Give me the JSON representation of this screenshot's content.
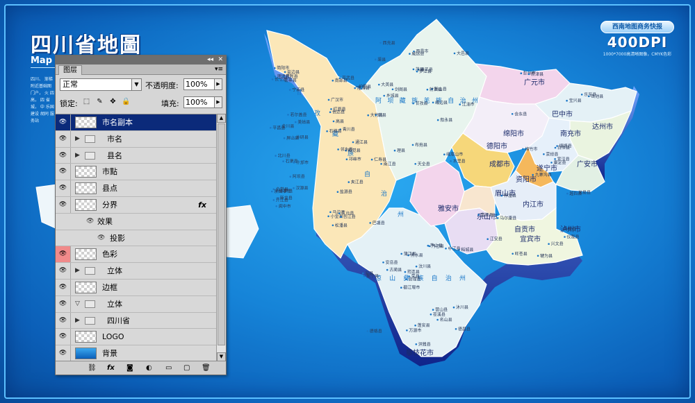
{
  "header": {
    "title": "四川省地圖",
    "subtitle": "Map",
    "description": "四川、 渐梯 附近基础图 门户， 火 四高， 四 省城， 中 乐国 建设 胡同 服务站"
  },
  "badge": {
    "pill": "西南地图商务快报",
    "brand": "400DPI",
    "tagline": "1000*7000高清晰图像，CMYK色彩"
  },
  "map": {
    "region_labels": [
      "甘",
      "孜",
      "藏",
      "族",
      "自",
      "治",
      "州",
      "阿坝藏族羌族自治州",
      "凉山彝族自治州"
    ],
    "cities": [
      "广元市",
      "巴中市",
      "达州市",
      "南充市",
      "绵阳市",
      "德阳市",
      "成都市",
      "遂宁市",
      "广安市",
      "资阳市",
      "眉山市",
      "内江市",
      "雅安市",
      "乐山市",
      "自贡市",
      "宜宾市",
      "泸州市",
      "攀枝花市"
    ],
    "counties": [
      "石渠县",
      "色达县",
      "甘孜县",
      "德格县",
      "白玉县",
      "新龙县",
      "炉霍县",
      "道孚县",
      "丹巴县",
      "康定县",
      "理塘县",
      "巴塘县",
      "乡城县",
      "稻城县",
      "九寨沟县",
      "若尔盖县",
      "松潘县",
      "茂县",
      "汶川县",
      "马尔康县",
      "金川县",
      "小金县",
      "理县",
      "黑水县",
      "壤塘县",
      "阿坝县",
      "红原县",
      "西昌市",
      "冕宁县",
      "越西县",
      "美姑县",
      "昭觉县",
      "布拖县",
      "会理县",
      "会东县",
      "宁南县",
      "盐源县",
      "木里县",
      "德昌县",
      "米易县",
      "盐边县",
      "青川县",
      "剑阁县",
      "苍溪县",
      "旺苍县",
      "平昌县",
      "通江县",
      "南江县",
      "万源市",
      "宣汉县",
      "开江县",
      "大竹县",
      "渠县",
      "营山县",
      "仪陇县",
      "阆中市",
      "南部县",
      "西充县",
      "蓬安县",
      "岳池县",
      "武胜县",
      "邻水县",
      "大英县",
      "安岳县",
      "乐至县",
      "简阳市",
      "隆昌县",
      "威远县",
      "荣县",
      "富顺县",
      "泸县",
      "合江县",
      "叙永县",
      "古蔺县",
      "江安县",
      "长宁县",
      "高县",
      "珙县",
      "筠连县",
      "兴文县",
      "屏山县",
      "马边县",
      "峨边县",
      "沐川县",
      "犍为县",
      "井研县",
      "夹江县",
      "峨眉山市",
      "洪雅县",
      "丹棱县",
      "青神县",
      "仁寿县",
      "彭山县",
      "名山县",
      "荥经县",
      "汉源县",
      "石棉县",
      "天全县",
      "芦山县",
      "宝兴县",
      "北川县",
      "平武县",
      "江油市",
      "安县",
      "梓潼县",
      "盐亭县",
      "三台县",
      "射洪县",
      "中江县",
      "绵竹市",
      "什邡市",
      "广汉市",
      "罗江县",
      "都江堰市",
      "彭州市",
      "崇州市",
      "邛崃市",
      "大邑县",
      "蒲江县",
      "新津县",
      "金堂县"
    ]
  },
  "layers_panel": {
    "collapse_icon": "◂◂",
    "close_icon": "✕",
    "tab_label": "图层",
    "menu_icon": "▾≡",
    "blend_mode": "正常",
    "blend_arrow": "▼",
    "opacity_label": "不透明度:",
    "opacity_value": "100%",
    "lock_label": "锁定:",
    "fill_label": "填充:",
    "fill_value": "100%",
    "stepper_icon": "▶",
    "lock_glyphs": [
      "⬚",
      "✎",
      "✥",
      "🔒"
    ],
    "layers": [
      {
        "name": "市名副本",
        "kind": "layer",
        "selected": true
      },
      {
        "name": "市名",
        "kind": "folder",
        "collapsed": true
      },
      {
        "name": "县名",
        "kind": "folder",
        "collapsed": true
      },
      {
        "name": "市點",
        "kind": "layer"
      },
      {
        "name": "县点",
        "kind": "layer"
      },
      {
        "name": "分界",
        "kind": "layer",
        "fx": "fx"
      },
      {
        "name": "效果",
        "kind": "effect"
      },
      {
        "name": "投影",
        "kind": "effect-item"
      },
      {
        "name": "色彩",
        "kind": "layer",
        "red_eye": true
      },
      {
        "name": "立体",
        "kind": "folder",
        "collapsed": true
      },
      {
        "name": "边框",
        "kind": "layer"
      },
      {
        "name": "立体",
        "kind": "folder",
        "collapsed": false
      },
      {
        "name": "四川省",
        "kind": "folder",
        "collapsed": true
      },
      {
        "name": "LOGO",
        "kind": "layer"
      },
      {
        "name": "背景",
        "kind": "layer",
        "bluebg": true
      }
    ],
    "bottom_icons": [
      "⛓",
      "fx",
      "◙",
      "◐",
      "▭",
      "▢",
      "🗑"
    ],
    "eye_glyph": "👁",
    "tri_collapsed": "▶",
    "tri_expanded": "▽",
    "scroll_up": "▲",
    "scroll_down": "▼"
  },
  "colors": {
    "background": "#1684d8",
    "ganzi": "#fbe7b8",
    "aba": "#e8f4ee",
    "liangshan": "#e4f1f6",
    "pink": "#f3d5ec",
    "chengdu": "#f6d77a",
    "side3d": "#1f3fb8"
  }
}
